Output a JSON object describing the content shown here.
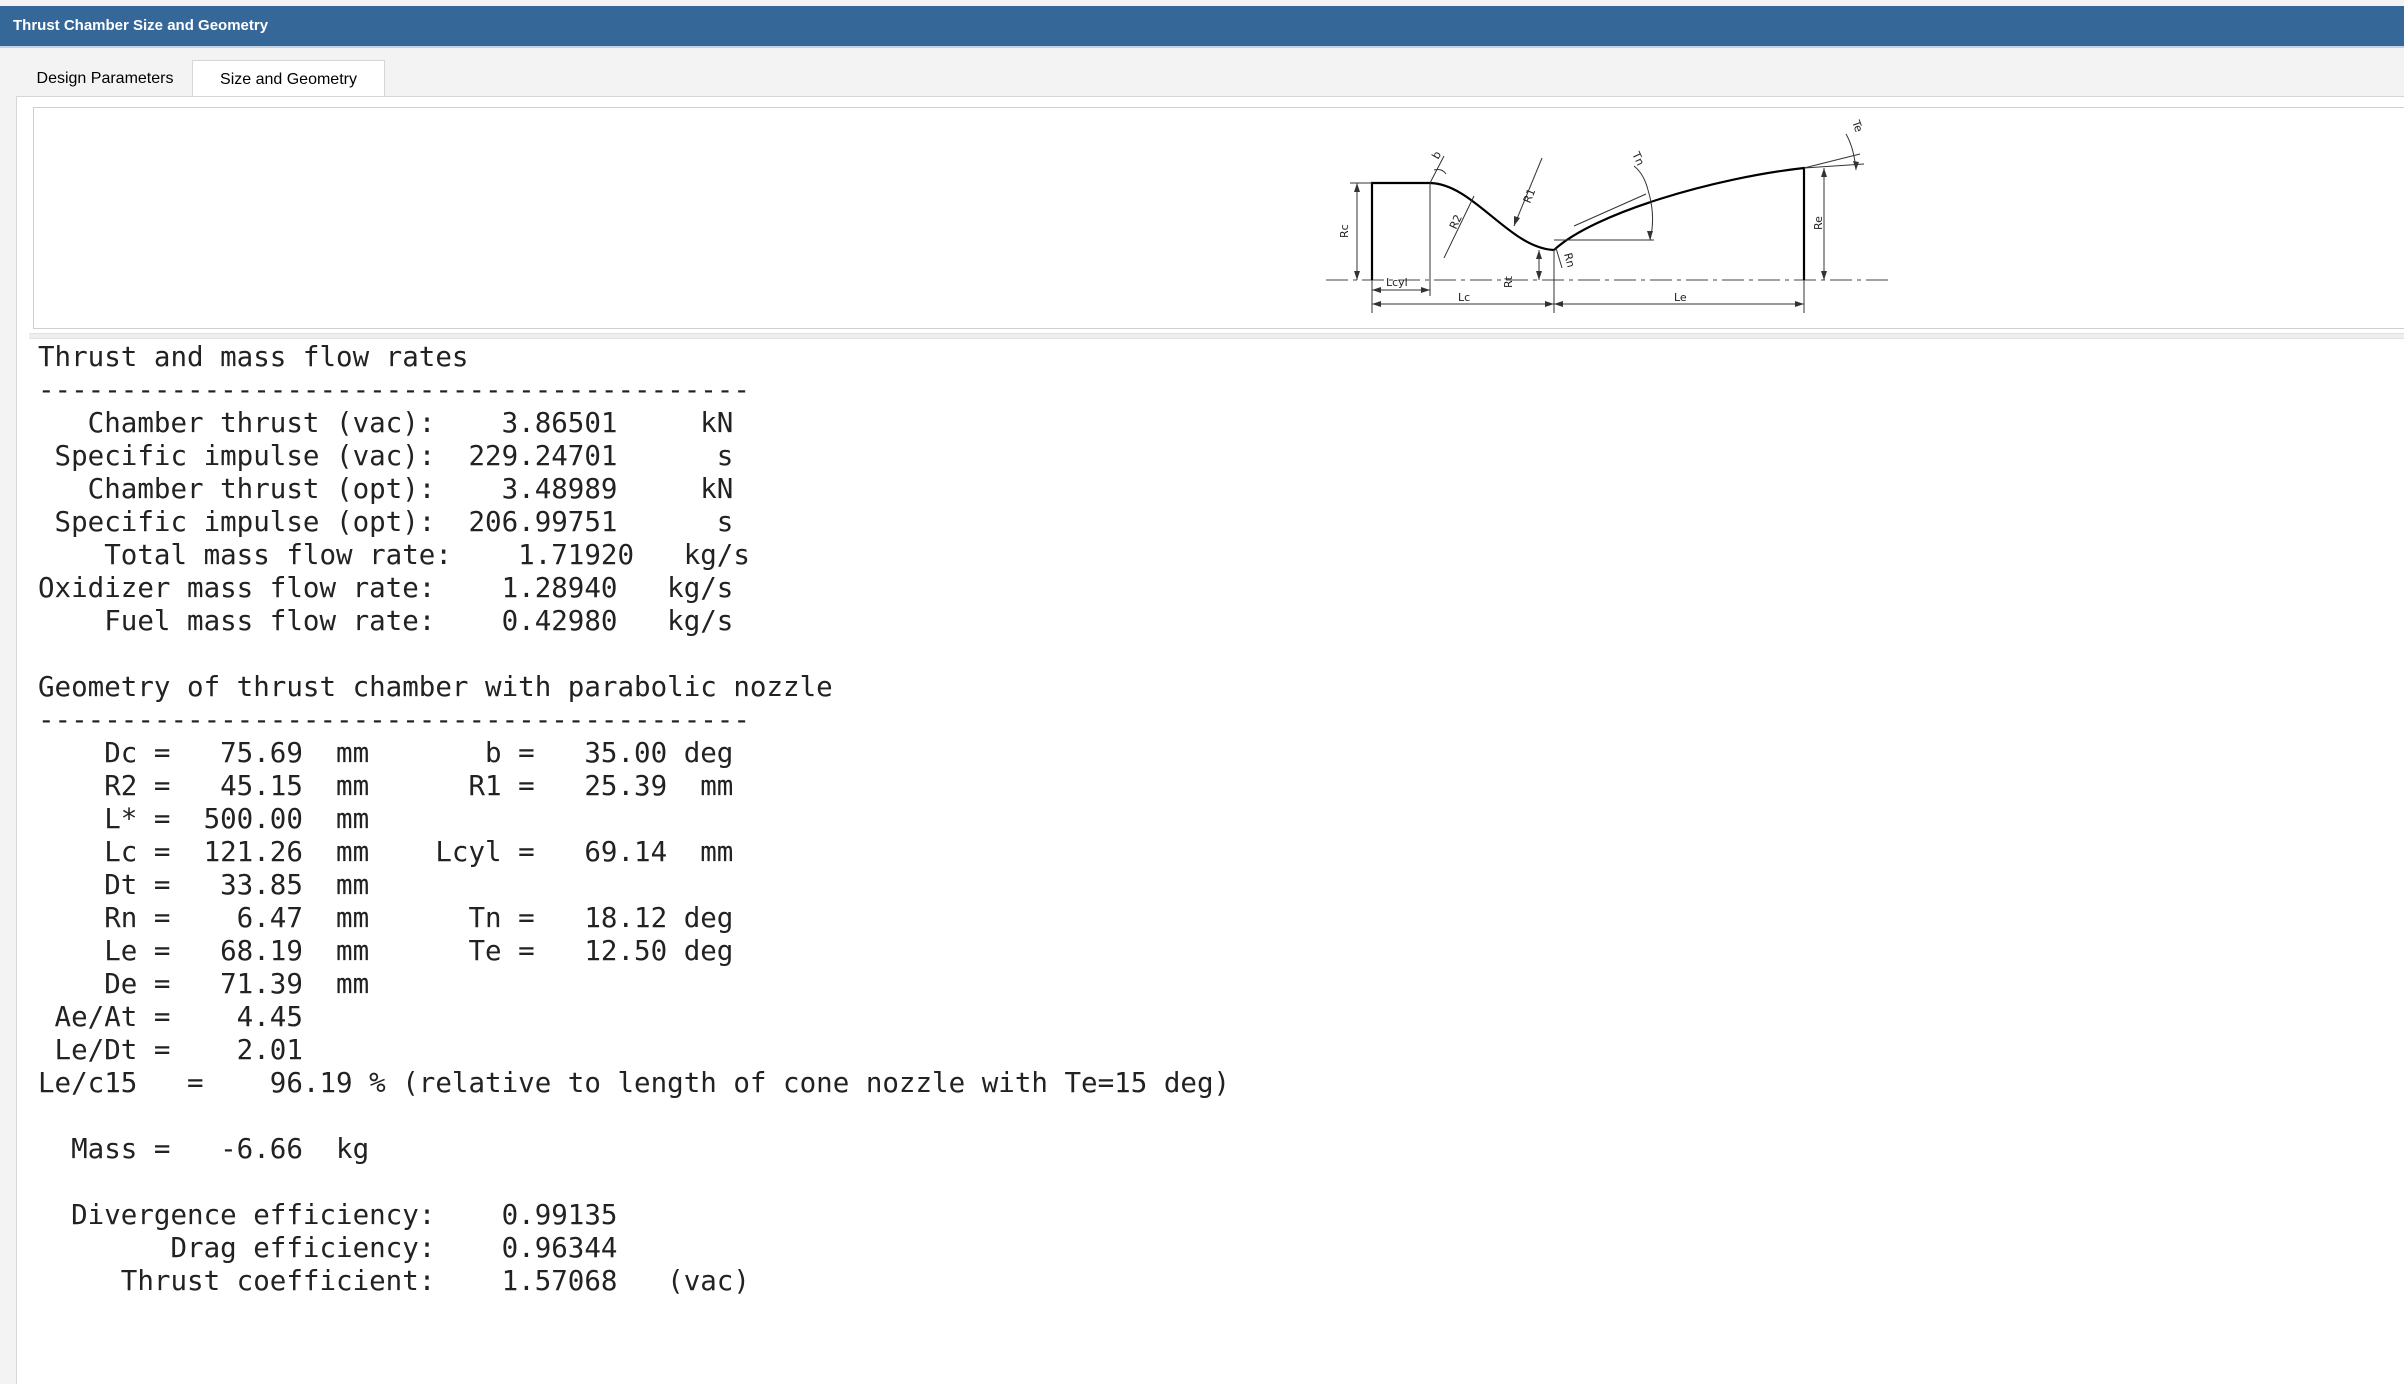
{
  "window": {
    "title": "Thrust Chamber Size and Geometry"
  },
  "tabs": [
    {
      "label": "Design Parameters",
      "selected": false
    },
    {
      "label": "Size and Geometry",
      "selected": true
    }
  ],
  "diagram": {
    "labels": {
      "rc": "Rc",
      "lcyl": "Lcyl",
      "lc": "Lc",
      "b": "b",
      "r2": "R2",
      "r1": "R1",
      "rt": "Rt",
      "rn": "Rn",
      "tn": "Tn",
      "le": "Le",
      "re": "Re",
      "te": "Te"
    }
  },
  "report_lines": [
    "Thrust and mass flow rates",
    "-------------------------------------------",
    "   Chamber thrust (vac):    3.86501     kN",
    " Specific impulse (vac):  229.24701      s",
    "   Chamber thrust (opt):    3.48989     kN",
    " Specific impulse (opt):  206.99751      s",
    "    Total mass flow rate:    1.71920   kg/s",
    "Oxidizer mass flow rate:    1.28940   kg/s",
    "    Fuel mass flow rate:    0.42980   kg/s",
    "",
    "Geometry of thrust chamber with parabolic nozzle",
    "-------------------------------------------",
    "    Dc =   75.69  mm       b =   35.00 deg",
    "    R2 =   45.15  mm      R1 =   25.39  mm",
    "    L* =  500.00  mm",
    "    Lc =  121.26  mm    Lcyl =   69.14  mm",
    "    Dt =   33.85  mm",
    "    Rn =    6.47  mm      Tn =   18.12 deg",
    "    Le =   68.19  mm      Te =   12.50 deg",
    "    De =   71.39  mm",
    " Ae/At =    4.45",
    " Le/Dt =    2.01",
    "Le/c15   =    96.19 % (relative to length of cone nozzle with Te=15 deg)",
    "",
    "  Mass =   -6.66  kg",
    "",
    "  Divergence efficiency:    0.99135",
    "        Drag efficiency:    0.96344",
    "     Thrust coefficient:    1.57068   (vac)"
  ]
}
